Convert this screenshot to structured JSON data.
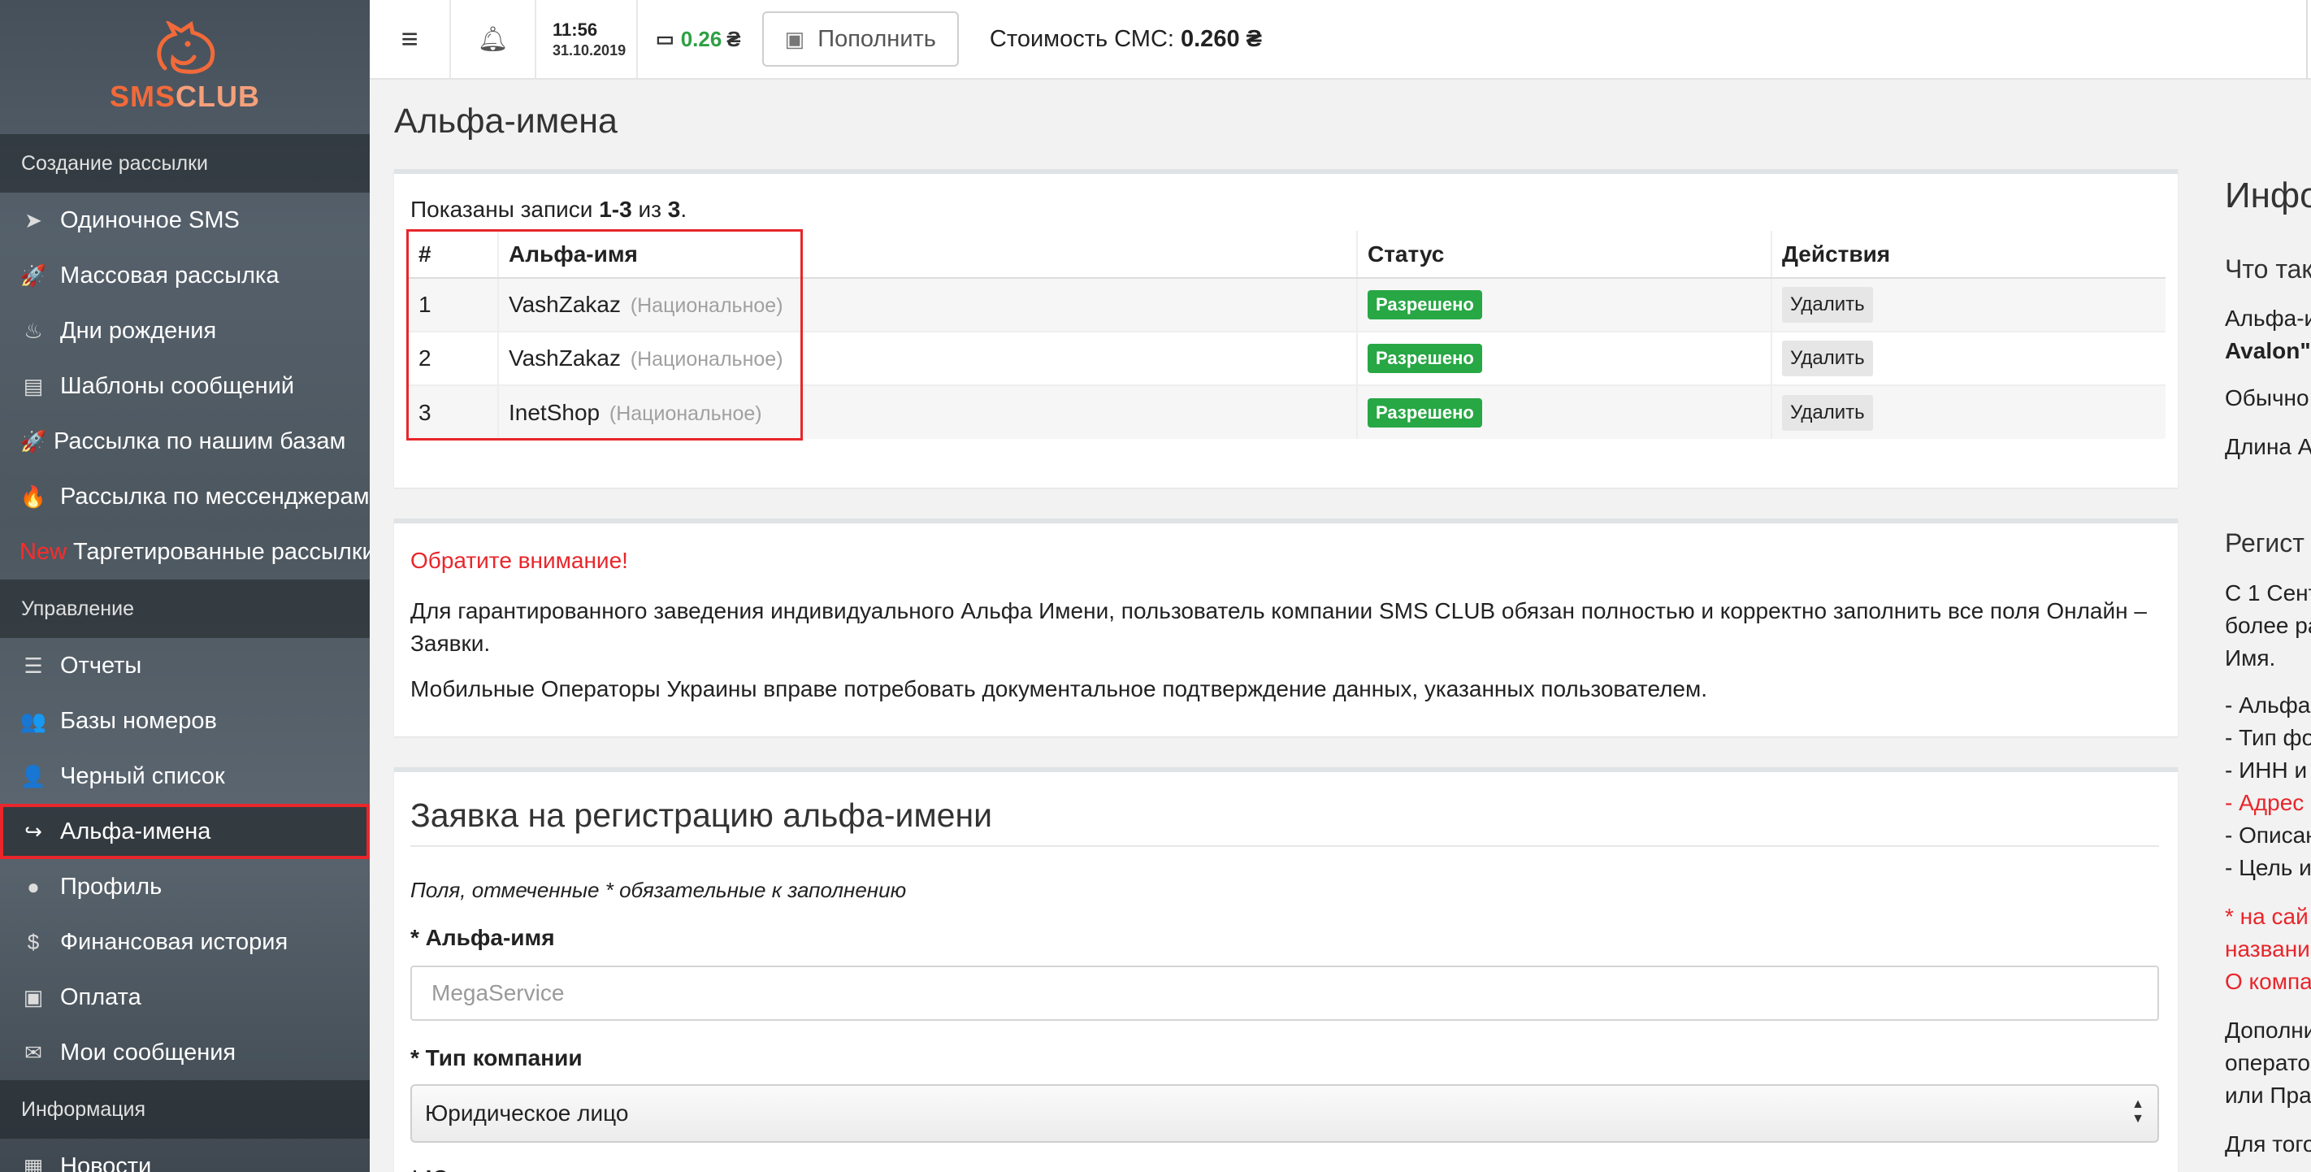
{
  "brand": {
    "logo_sms": "SMS",
    "logo_club": "CLUB",
    "accent": "#f26a3a"
  },
  "sidebar": {
    "sections": [
      {
        "label": "Создание рассылки",
        "items": [
          {
            "label": "Одиночное SMS",
            "icon": "paper-plane-icon"
          },
          {
            "label": "Массовая рассылка",
            "icon": "rocket-icon"
          },
          {
            "label": "Дни рождения",
            "icon": "birthday-cake-icon"
          },
          {
            "label": "Шаблоны сообщений",
            "icon": "document-icon"
          },
          {
            "label": "Рассылка по нашим базам",
            "icon": "rocket-icon"
          },
          {
            "label": "Рассылка по мессенджерам",
            "icon": "fire-icon"
          },
          {
            "label": "Таргетированные рассылки",
            "badge": "New"
          }
        ]
      },
      {
        "label": "Управление",
        "items": [
          {
            "label": "Отчеты",
            "icon": "list-icon"
          },
          {
            "label": "Базы номеров",
            "icon": "users-icon"
          },
          {
            "label": "Черный список",
            "icon": "user-block-icon"
          },
          {
            "label": "Альфа-имена",
            "icon": "share-icon",
            "active": true
          },
          {
            "label": "Профиль",
            "icon": "user-icon"
          },
          {
            "label": "Финансовая история",
            "icon": "dollar-icon"
          },
          {
            "label": "Оплата",
            "icon": "money-icon"
          },
          {
            "label": "Мои сообщения",
            "icon": "envelope-icon"
          }
        ]
      },
      {
        "label": "Информация",
        "items": [
          {
            "label": "Новости",
            "icon": "newspaper-icon"
          }
        ]
      }
    ]
  },
  "topbar": {
    "time": "11:56",
    "date": "31.10.2019",
    "balance": "0.26",
    "currency": "₴",
    "topup_label": "Пополнить",
    "cost_label": "Стоимость СМС:",
    "cost_value": "0.260 ₴"
  },
  "page": {
    "title": "Альфа-имена"
  },
  "alpha_table": {
    "records_prefix": "Показаны записи",
    "records_range": "1-3",
    "records_of": "из",
    "records_total": "3",
    "columns": [
      "#",
      "Альфа-имя",
      "Статус",
      "Действия"
    ],
    "rows": [
      {
        "num": "1",
        "name": "VashZakaz",
        "type": "(Национальное)",
        "status": "Разрешено",
        "action": "Удалить"
      },
      {
        "num": "2",
        "name": "VashZakaz",
        "type": "(Национальное)",
        "status": "Разрешено",
        "action": "Удалить"
      },
      {
        "num": "3",
        "name": "InetShop",
        "type": "(Национальное)",
        "status": "Разрешено",
        "action": "Удалить"
      }
    ]
  },
  "notice": {
    "title": "Обратите внимание!",
    "p1": "Для гарантированного заведения индивидуального Альфа Имени, пользователь компании SMS CLUB обязан полностью и корректно заполнить все поля Онлайн – Заявки.",
    "p2": "Мобильные Операторы Украины вправе потребовать документальное подтверждение данных, указанных пользователем."
  },
  "form": {
    "title": "Заявка на регистрацию альфа-имени",
    "note": "Поля, отмеченные * обязательные к заполнению",
    "alpha_label": "* Альфа-имя",
    "alpha_placeholder": "MegaService",
    "company_type_label": "* Тип компании",
    "company_type_value": "Юридическое лицо",
    "company_name_label": "* Юридическое название компании"
  },
  "info_panel": {
    "title": "Инфо",
    "subtitle": "Что так",
    "lines": [
      "Альфа-и",
      "Avalon\"",
      "Обычно",
      "Длина А"
    ],
    "reg_title": "Регист",
    "reg_lines": [
      "С 1 Сент",
      "более ра",
      "Имя."
    ],
    "list": [
      "- Альфа",
      "- Тип фо",
      "- ИНН и",
      "- Адрес",
      "- Описан",
      "- Цель и"
    ],
    "red_lines": [
      "* на сай",
      "названи",
      "О компа"
    ],
    "extra_lines": [
      "Дополни",
      "операто",
      "или Пра",
      "Для того"
    ]
  }
}
